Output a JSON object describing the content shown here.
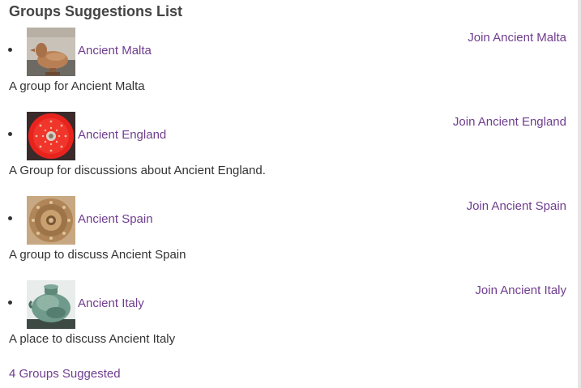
{
  "title": "Groups Suggestions List",
  "groups": [
    {
      "name": "Ancient Malta",
      "join_label": "Join Ancient Malta",
      "description": "A group for Ancient Malta",
      "thumbnail_icon": "clay-bird-figurine"
    },
    {
      "name": "Ancient England",
      "join_label": "Join Ancient England",
      "description": "A Group for discussions about Ancient England.",
      "thumbnail_icon": "red-enamel-shield-disc"
    },
    {
      "name": "Ancient Spain",
      "join_label": "Join Ancient Spain",
      "description": "A group to discuss Ancient Spain",
      "thumbnail_icon": "bronze-ornamental-brooch"
    },
    {
      "name": "Ancient Italy",
      "join_label": "Join Ancient Italy",
      "description": "A place to discuss Ancient Italy",
      "thumbnail_icon": "green-bronze-vessel"
    }
  ],
  "footer_label": "4 Groups Suggested",
  "colors": {
    "link": "#6f3d8f",
    "text": "#333333",
    "title": "#444444"
  }
}
